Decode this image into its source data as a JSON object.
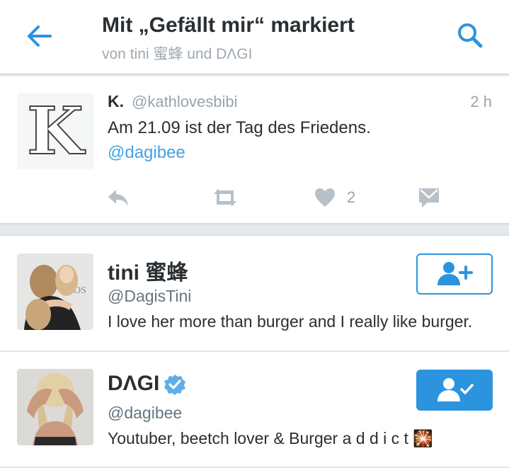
{
  "header": {
    "title": "Mit „Gefällt mir“ markiert",
    "subtitle": "von tini 蜜蜂 und DΛGI",
    "back_icon": "arrow-left-icon",
    "search_icon": "search-icon"
  },
  "tweet": {
    "avatar_letter": "K",
    "name": "K.",
    "handle": "@kathlovesbibi",
    "time": "2 h",
    "text": "Am 21.09 ist der Tag des Friedens.",
    "mention": "@dagibee",
    "like_count": "2",
    "actions": [
      "reply-icon",
      "retweet-icon",
      "heart-icon",
      "direct-message-icon"
    ]
  },
  "users": [
    {
      "name": "tini 蜜蜂",
      "handle": "@DagisTini",
      "bio": "I love her more than burger and I really like burger.",
      "following": false,
      "verified": false
    },
    {
      "name": "DΛGI",
      "handle": "@dagibee",
      "bio": "Youtuber, beetch lover & Burger a d d i c t 🎇",
      "following": true,
      "verified": true
    }
  ],
  "colors": {
    "accent": "#2c94df",
    "muted": "#9aa3ab",
    "text": "#292f33"
  }
}
